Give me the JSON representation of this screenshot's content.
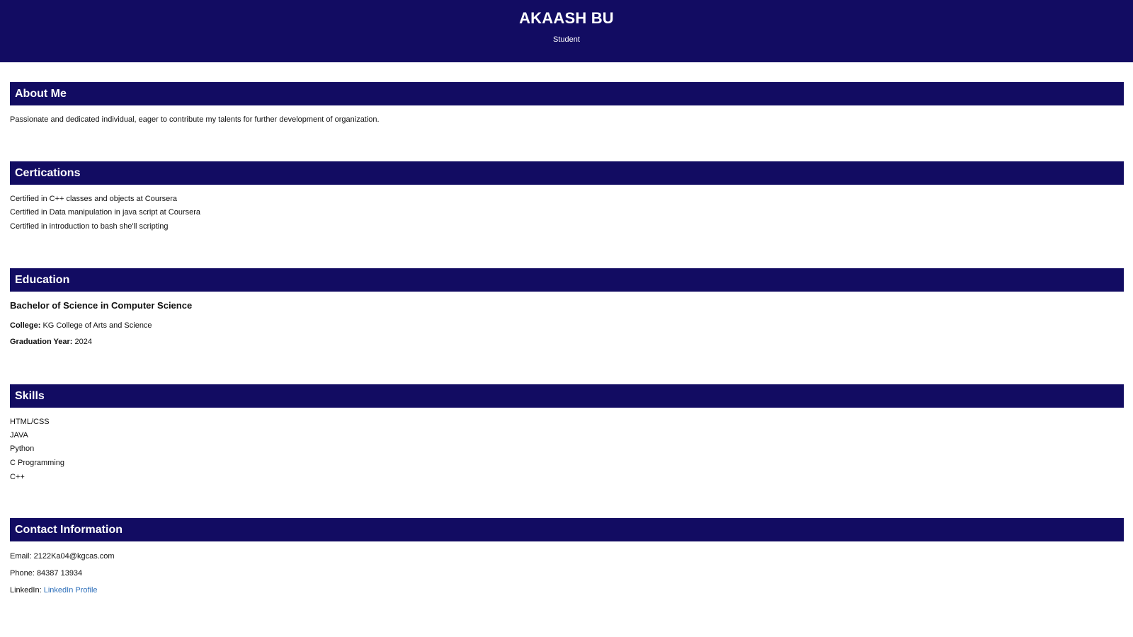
{
  "header": {
    "name": "AKAASH BU",
    "role": "Student"
  },
  "about": {
    "title": "About Me",
    "text": "Passionate and dedicated individual, eager to contribute my talents for further development of organization."
  },
  "certifications": {
    "title": "Certications",
    "items": [
      "Certified in C++ classes and objects at Coursera",
      "Certified in Data manipulation in java script at Coursera",
      "Certified in introduction to bash she'll scripting"
    ]
  },
  "education": {
    "title": "Education",
    "degree": "Bachelor of Science in Computer Science",
    "college_label": "College:",
    "college": "KG College of Arts and Science",
    "year_label": "Graduation Year:",
    "year": "2024"
  },
  "skills": {
    "title": "Skills",
    "items": [
      "HTML/CSS",
      "JAVA",
      "Python",
      "C Programming",
      "C++"
    ]
  },
  "contact": {
    "title": "Contact Information",
    "email_label": "Email:",
    "email": "2122Ka04@kgcas.com",
    "phone_label": "Phone:",
    "phone": "84387 13934",
    "linkedin_label": "LinkedIn:",
    "linkedin_text": "LinkedIn Profile"
  },
  "colors": {
    "header_bg": "#120c62",
    "link": "#2d6fba"
  }
}
